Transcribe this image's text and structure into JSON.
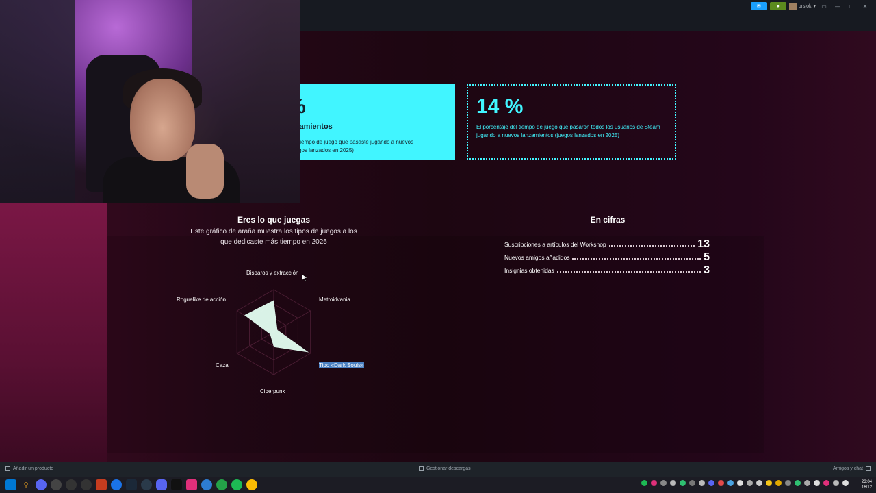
{
  "topbar": {
    "username": "orslok",
    "window_controls": [
      "monitor-icon",
      "minimize-icon",
      "maximize-icon",
      "close-icon"
    ]
  },
  "card_primary": {
    "big_value": "%",
    "subtitle": "zamientos",
    "description": "tiempo de juego que pasaste jugando a nuevos\ngos lanzados en 2025)"
  },
  "card_secondary": {
    "big_value": "14 %",
    "description": "El porcentaje del tiempo de juego que pasaron todos los usuarios de Steam jugando a nuevos lanzamientos (juegos lanzados en 2025)"
  },
  "spider": {
    "title": "Eres lo que juegas",
    "description": "Este gráfico de araña muestra los tipos de juegos a los que dedicaste más tiempo en 2025",
    "axes": [
      {
        "label": "Disparos y extracción",
        "value": 0.75
      },
      {
        "label": "Metroidvania",
        "value": 0.1
      },
      {
        "label": "Tipo «Dark Souls»",
        "value": 0.95
      },
      {
        "label": "Ciberpunk",
        "value": 0.35
      },
      {
        "label": "Caza",
        "value": 0.1
      },
      {
        "label": "Roguelike de acción",
        "value": 0.8
      }
    ],
    "selected_axis": "Tipo «Dark Souls»",
    "fill_color": "#e4fff2",
    "grid_color": "#4a1d33"
  },
  "cifras": {
    "title": "En cifras",
    "rows": [
      {
        "label": "Suscripciones a artículos del Workshop",
        "value": "13"
      },
      {
        "label": "Nuevos amigos añadidos",
        "value": "5"
      },
      {
        "label": "Insignias obtenidas",
        "value": "3"
      }
    ]
  },
  "statusbar": {
    "add_product": "Añadir un producto",
    "manage_downloads": "Gestionar descargas",
    "friends_chat": "Amigos y chat"
  },
  "taskbar": {
    "time": "23:04",
    "date": "16/12"
  },
  "colors": {
    "accent_cyan": "#41f5ff",
    "announce_blue": "#1a9fff",
    "notif_green": "#5c8b1e"
  }
}
